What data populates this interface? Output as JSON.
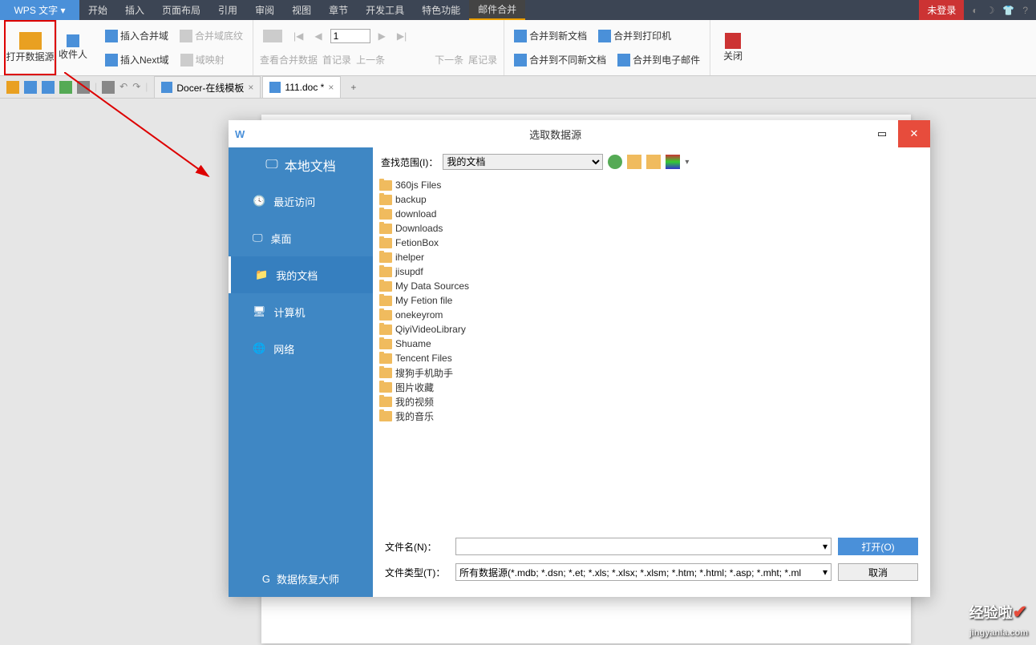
{
  "app": {
    "name": "WPS 文字"
  },
  "menu": {
    "items": [
      "开始",
      "插入",
      "页面布局",
      "引用",
      "审阅",
      "视图",
      "章节",
      "开发工具",
      "特色功能",
      "邮件合并"
    ],
    "active": 9,
    "login": "未登录"
  },
  "ribbon": {
    "open_source": "打开数据源",
    "recipients": "收件人",
    "insert_field": "插入合并域",
    "field_shading": "合并域底纹",
    "insert_next": "插入Next域",
    "field_map": "域映射",
    "view_fields": "查看合并数据",
    "first_rec": "首记录",
    "prev_rec": "上一条",
    "page": "1",
    "next_rec": "下一条",
    "last_rec": "尾记录",
    "merge_new": "合并到新文档",
    "merge_diff": "合并到不同新文档",
    "merge_print": "合并到打印机",
    "merge_email": "合并到电子邮件",
    "close": "关闭"
  },
  "tabs": {
    "t1": "Docer-在线模板",
    "t2": "111.doc *"
  },
  "dialog": {
    "title": "选取数据源",
    "side_head": "本地文档",
    "side_items": [
      "最近访问",
      "桌面",
      "我的文档",
      "计算机",
      "网络"
    ],
    "side_active": 2,
    "side_foot": "数据恢复大师",
    "lookin_label": "查找范围(I)：",
    "lookin_value": "我的文档",
    "files": [
      "360js Files",
      "backup",
      "download",
      "Downloads",
      "FetionBox",
      "ihelper",
      "jisupdf",
      "My Data Sources",
      "My Fetion file",
      "onekeyrom",
      "QiyiVideoLibrary",
      "Shuame",
      "Tencent Files",
      "搜狗手机助手",
      "图片收藏",
      "我的视频",
      "我的音乐"
    ],
    "fname_label": "文件名(N)：",
    "ftype_label": "文件类型(T)：",
    "ftype_value": "所有数据源(*.mdb; *.dsn; *.et; *.xls; *.xlsx; *.xlsm; *.htm; *.html; *.asp; *.mht; *.ml",
    "open": "打开(O)",
    "cancel": "取消"
  },
  "watermark": {
    "brand": "经验啦",
    "url": "jingyanla.com"
  }
}
